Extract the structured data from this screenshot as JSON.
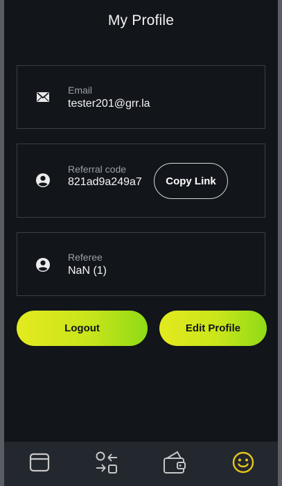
{
  "header": {
    "title": "My Profile"
  },
  "email_card": {
    "icon": "envelope-icon",
    "label": "Email",
    "value": "tester201@grr.la"
  },
  "referral_card": {
    "icon": "account-circle-icon",
    "label": "Referral code",
    "value": "821ad9a249a7",
    "copy_label": "Copy Link"
  },
  "referee_card": {
    "icon": "account-circle-icon",
    "label": "Referee",
    "value": "NaN (1)"
  },
  "actions": {
    "logout_label": "Logout",
    "edit_profile_label": "Edit Profile"
  },
  "bottom_nav": {
    "items": [
      {
        "icon": "browser-window-icon",
        "active": false
      },
      {
        "icon": "swap-arrows-icon",
        "active": false
      },
      {
        "icon": "wallet-icon",
        "active": false
      },
      {
        "icon": "smiley-face-icon",
        "active": true
      }
    ]
  },
  "colors": {
    "background": "#12151a",
    "card_border": "#3b3f46",
    "accent_yellow": "#e3ea1e",
    "accent_green": "#8fdb16",
    "nav_background": "#23272e",
    "nav_icon": "#c8c8c8",
    "nav_icon_active": "#e6c619"
  }
}
